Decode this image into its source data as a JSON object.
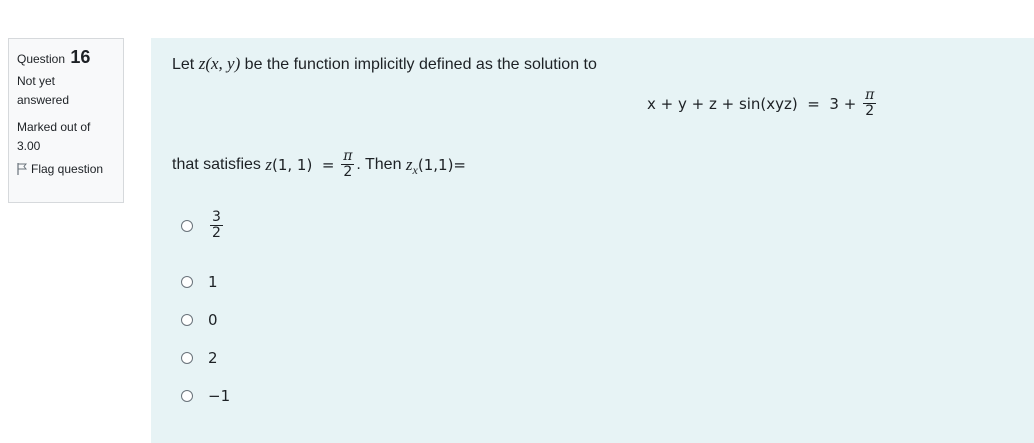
{
  "info": {
    "question_label": "Question",
    "question_number": "16",
    "state": [
      "Not yet",
      "answered"
    ],
    "grade": [
      "Marked out of",
      "3.00"
    ],
    "flag_label": "Flag question"
  },
  "question": {
    "intro_prefix": "Let ",
    "intro_z": "z",
    "intro_args": "(x, y)",
    "intro_suffix": " be the function implicitly defined as the solution to",
    "equation_lhs": "x + y + z + sin(xyz)  =  3 + ",
    "pi": "π",
    "two": "2",
    "cond_prefix": "that satisfies ",
    "cond_z": "z",
    "cond_args": "(1, 1)  = ",
    "cond_then": ". Then ",
    "cond_z2": "z",
    "cond_sub": "x",
    "cond_end": "(1,1)="
  },
  "answers": {
    "options": [
      {
        "num": "3",
        "den": "2"
      },
      {
        "value": "1"
      },
      {
        "value": "0"
      },
      {
        "value": "2"
      },
      {
        "value": "−1"
      }
    ]
  }
}
